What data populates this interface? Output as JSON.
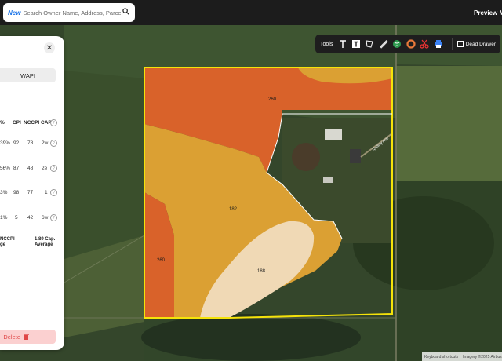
{
  "search": {
    "badge": "New",
    "placeholder": "Search Owner Name, Address, Parcel Id"
  },
  "header": {
    "preview_label": "Preview Ma"
  },
  "toolbar": {
    "tools_label": "Tools",
    "dead_drawer_label": "Dead Drawer",
    "icons": [
      "text-tool-icon",
      "text-box-icon",
      "polygon-tool-icon",
      "ruler-icon",
      "globe-icon",
      "circle-tool-icon",
      "scissors-icon",
      "printer-icon",
      "square-icon"
    ]
  },
  "panel": {
    "tab_label": "WAPI",
    "columns": [
      "%",
      "CPI",
      "NCCPI",
      "CAP"
    ],
    "rows": [
      {
        "pct": "39%",
        "cpi": "92",
        "nccpi": "78",
        "cap": "2w"
      },
      {
        "pct": "56%",
        "cpi": "87",
        "nccpi": "48",
        "cap": "2e"
      },
      {
        "pct": "3%",
        "cpi": "98",
        "nccpi": "77",
        "cap": "1"
      },
      {
        "pct": "1%",
        "cpi": "5",
        "nccpi": "42",
        "cap": "6w"
      }
    ],
    "summary_left_top": "NCCPI",
    "summary_left_bottom": "ge",
    "summary_right_top": "1.89 Cap.",
    "summary_right_bottom": "Average",
    "delete_label": "Delete"
  },
  "map": {
    "soil_labels": [
      "260",
      "182",
      "260",
      "188"
    ],
    "road_label": "Quarry Ave",
    "colors": {
      "boundary": "#f5e30a",
      "soil_a": "#d9622a",
      "soil_b": "#dba033",
      "soil_c": "#f0d9b5"
    }
  },
  "attribution": {
    "shortcuts": "Keyboard shortcuts",
    "imagery": "Imagery ©2025 Airbus"
  }
}
